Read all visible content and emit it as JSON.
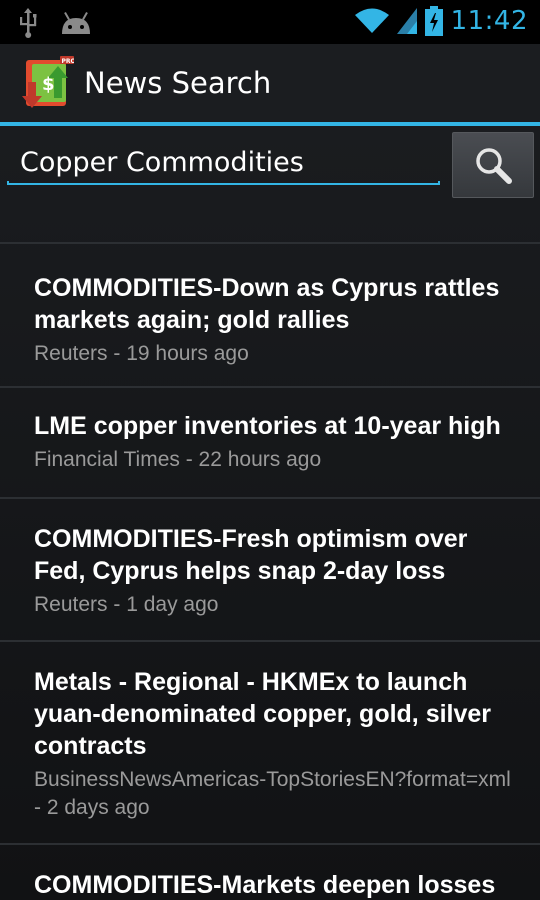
{
  "status_bar": {
    "time": "11:42",
    "left_icons": [
      "usb-icon",
      "android-icon"
    ],
    "right_icons": [
      "wifi-icon",
      "signal-icon",
      "battery-icon"
    ],
    "accent_color": "#33b5e5"
  },
  "action_bar": {
    "title": "News Search",
    "logo_icon": "news-search-pro-logo-icon"
  },
  "search": {
    "value": "Copper Commodities",
    "button_icon": "search-icon"
  },
  "results": [
    {
      "title": "COMMODITIES-Down as Cyprus rattles markets again; gold rallies",
      "meta": "Reuters - 19 hours ago"
    },
    {
      "title": "LME copper inventories at 10-year high",
      "meta": "Financial Times - 22 hours ago"
    },
    {
      "title": "COMMODITIES-Fresh optimism over Fed, Cyprus helps snap 2-day loss",
      "meta": "Reuters - 1 day ago"
    },
    {
      "title": "Metals - Regional - HKMEx to launch yuan-denominated copper, gold, silver contracts",
      "meta": "BusinessNewsAmericas-TopStoriesEN?format=xml - 2 days ago"
    },
    {
      "title": "COMMODITIES-Markets deepen losses",
      "meta": ""
    }
  ]
}
